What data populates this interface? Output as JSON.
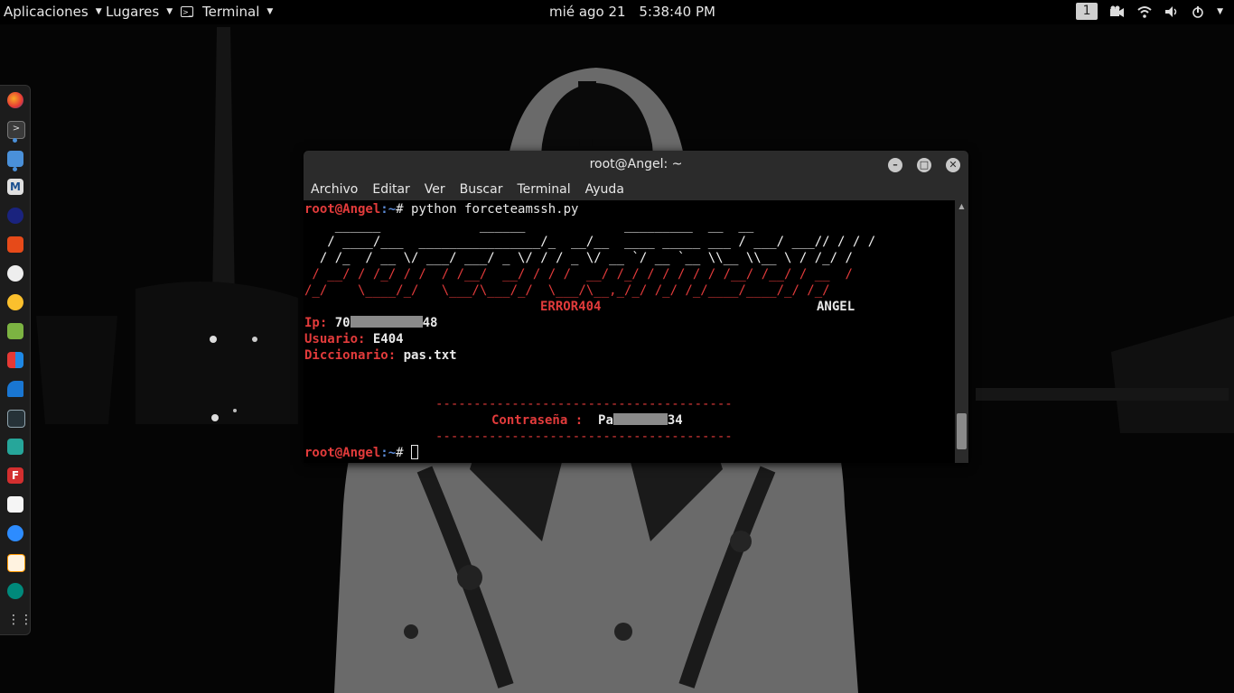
{
  "topbar": {
    "applications": "Aplicaciones",
    "places": "Lugares",
    "terminal": "Terminal",
    "date": "mié ago 21",
    "time": "5:38:40 PM",
    "workspace": "1"
  },
  "dock": {
    "icons": [
      "firefox-icon",
      "terminal-icon",
      "files-icon",
      "metasploit-icon",
      "burpsuite-icon",
      "armitage-icon",
      "maltego-icon",
      "beef-icon",
      "leafpad-icon",
      "office-icon",
      "wireshark-icon",
      "kali-tool-icon",
      "user-tool-icon",
      "faraday-icon",
      "text-editor-icon",
      "zoom-icon",
      "notes-icon",
      "network-icon",
      "show-apps-icon"
    ]
  },
  "window": {
    "title": "root@Angel: ~",
    "menu": [
      "Archivo",
      "Editar",
      "Ver",
      "Buscar",
      "Terminal",
      "Ayuda"
    ]
  },
  "terminal": {
    "prompt_user": "root@Angel",
    "prompt_path": ":~",
    "prompt_symbol": "# ",
    "command": "python forceteamssh.py",
    "ascii": [
      "    ______             ______             _________  __  __",
      "   / ____/___  ________________/_  __/__  ____ _____ ___ / ___/ ___// / / /",
      "  / /_  / __ \\/ ___/ ___/ _ \\/ / / _ \\/ __ `/ __ `__ \\\\__ \\\\__ \\ / /_/ /",
      " / __/ / /_/ / /  / /__/  __/ / / /  __/ /_/ / / / / / /__/ /__/ / __  /",
      "/_/    \\____/_/   \\___/\\___/_/  \\___/\\__,_/_/ /_/ /_/____/____/_/ /_/"
    ],
    "error_label": "ERROR404",
    "author_label": "ANGEL",
    "ip_label": "Ip:",
    "ip_prefix": "70",
    "ip_suffix": "48",
    "user_label": "Usuario:",
    "user_value": "E404",
    "dict_label": "Diccionario:",
    "dict_value": "pas.txt",
    "divider": "---------------------------------------",
    "password_label": "Contraseña :",
    "password_prefix": "Pa",
    "password_suffix": "34"
  }
}
